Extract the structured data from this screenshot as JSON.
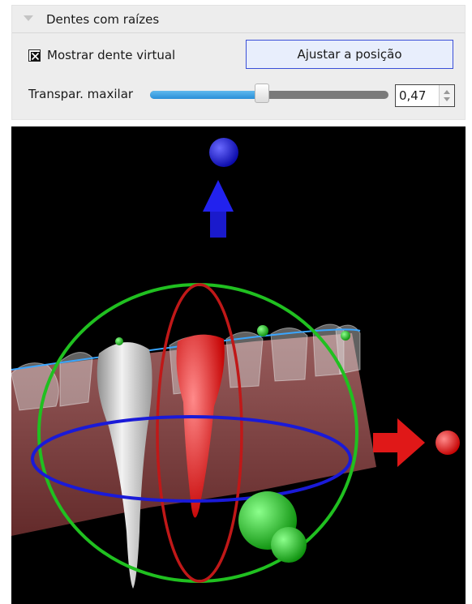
{
  "panel": {
    "section_title": "Dentes com raízes",
    "checkbox": {
      "label": "Mostrar dente virtual",
      "checked": true
    },
    "button_label": "Ajustar a posição",
    "slider": {
      "label": "Transpar. maxilar",
      "value": 0.47,
      "display_value": "0,47"
    }
  },
  "colors": {
    "accent": "#3a4fd8",
    "slider_fill": "#2a8fd8",
    "gizmo_x": "#ff1a1a",
    "gizmo_y": "#19c919",
    "gizmo_z": "#1a1aff"
  },
  "viewport": {
    "description_icons": [
      "translate-z-arrow-icon",
      "translate-x-arrow-icon",
      "rotation-ring-icon"
    ]
  }
}
